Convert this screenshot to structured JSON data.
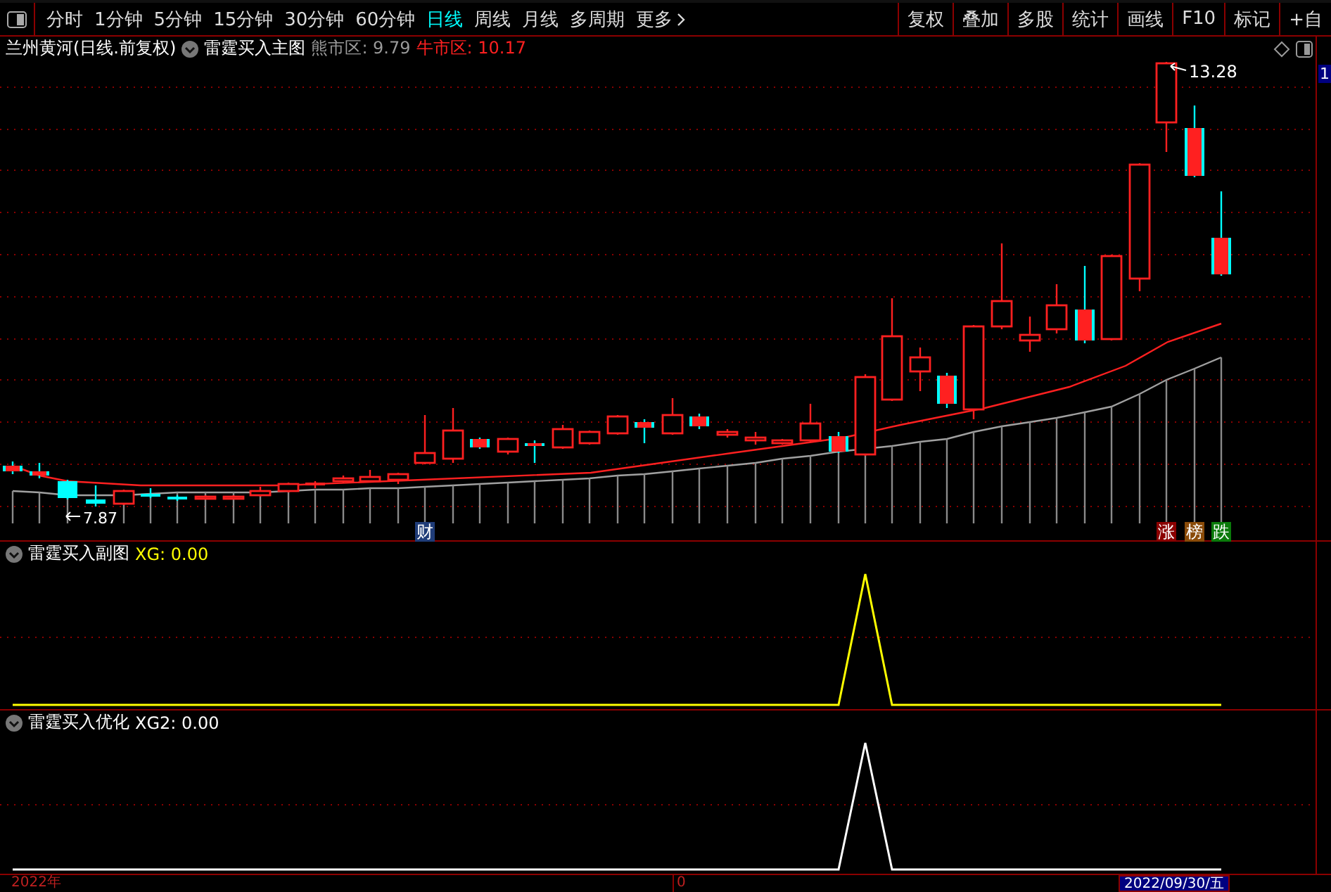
{
  "toolbar": {
    "periods": [
      {
        "label": "分时",
        "selected": false
      },
      {
        "label": "1分钟",
        "selected": false
      },
      {
        "label": "5分钟",
        "selected": false
      },
      {
        "label": "15分钟",
        "selected": false
      },
      {
        "label": "30分钟",
        "selected": false
      },
      {
        "label": "60分钟",
        "selected": false
      },
      {
        "label": "日线",
        "selected": true
      },
      {
        "label": "周线",
        "selected": false
      },
      {
        "label": "月线",
        "selected": false
      },
      {
        "label": "多周期",
        "selected": false
      },
      {
        "label": "更多",
        "selected": false
      }
    ],
    "actions": [
      "复权",
      "叠加",
      "多股",
      "统计",
      "画线",
      "F10",
      "标记",
      "+自"
    ]
  },
  "main_pane": {
    "stock": "兰州黄河(日线.前复权)",
    "indicator": "雷霆买入主图",
    "bear_zone": "熊市区: 9.79",
    "bull_zone": "牛市区: 10.17",
    "high_label": "13.28",
    "low_label": "7.87",
    "axis_label": "1",
    "markers": [
      {
        "text": "财",
        "color": "#1f3c78"
      },
      {
        "text": "涨",
        "color": "#8b0000"
      },
      {
        "text": "榜",
        "color": "#8a4b08"
      },
      {
        "text": "跌",
        "color": "#0a7a0a"
      }
    ]
  },
  "sub_panes": [
    {
      "title": "雷霆买入副图",
      "value": "XG: 0.00",
      "color": "#ffff00"
    },
    {
      "title": "雷霆买入优化",
      "value": "XG2: 0.00",
      "color": "#ffffff"
    }
  ],
  "date_axis": {
    "year": "2022年",
    "tick": "0",
    "cursor_date": "2022/09/30/五"
  }
}
